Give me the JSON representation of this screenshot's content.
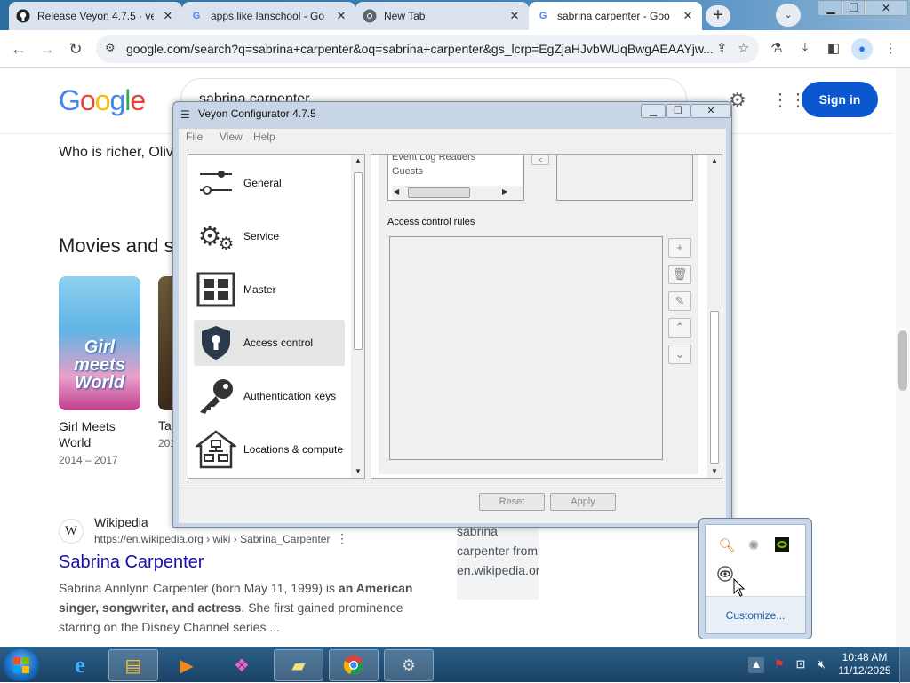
{
  "browser": {
    "tabs": [
      {
        "title": "Release Veyon 4.7.5 · ve",
        "icon": "github-icon"
      },
      {
        "title": "apps like lanschool - Go",
        "icon": "google-icon"
      },
      {
        "title": "New Tab",
        "icon": "chrome-icon"
      },
      {
        "title": "sabrina carpenter - Goo",
        "icon": "google-icon",
        "active": true
      }
    ],
    "url": "google.com/search?q=sabrina+carpenter&oq=sabrina+carpenter&gs_lcrp=EgZjaHJvbWUqBwgAEAAYjw..."
  },
  "google": {
    "logo": "Google",
    "query": "sabrina carpenter",
    "signin": "Sign in",
    "question": "Who is richer, Oliv",
    "movies_heading": "Movies and s",
    "movie1": {
      "title": "Girl Meets World",
      "years": "2014 – 2017",
      "poster_text": "Girl meets World"
    },
    "movie2": {
      "title": "Ta",
      "years": "201"
    },
    "result": {
      "site": "Wikipedia",
      "url": "https://en.wikipedia.org › wiki › Sabrina_Carpenter",
      "title": "Sabrina Carpenter",
      "snippet_pre": "Sabrina Annlynn Carpenter (born May 11, 1999) is ",
      "snippet_bold": "an American singer, songwriter, and actress",
      "snippet_post": ". She first gained prominence starring on the Disney Channel series ...",
      "image_alt": "sabrina carpenter from en.wikipedia.org"
    }
  },
  "veyon": {
    "title": "Veyon Configurator 4.7.5",
    "menu": [
      "File",
      "View",
      "Help"
    ],
    "nav": [
      {
        "label": "General",
        "icon": "slider-icon"
      },
      {
        "label": "Service",
        "icon": "gears-icon"
      },
      {
        "label": "Master",
        "icon": "grid-icon"
      },
      {
        "label": "Access control",
        "icon": "shield-lock-icon",
        "selected": true
      },
      {
        "label": "Authentication keys",
        "icon": "key-icon"
      },
      {
        "label": "Locations & compute",
        "icon": "network-icon"
      }
    ],
    "groups": [
      "Event Log Readers",
      "Guests"
    ],
    "rules_label": "Access control rules",
    "reset": "Reset",
    "apply": "Apply"
  },
  "tray": {
    "customize": "Customize..."
  },
  "taskbar": {
    "time": "10:48 AM",
    "date": "11/12/2025"
  }
}
